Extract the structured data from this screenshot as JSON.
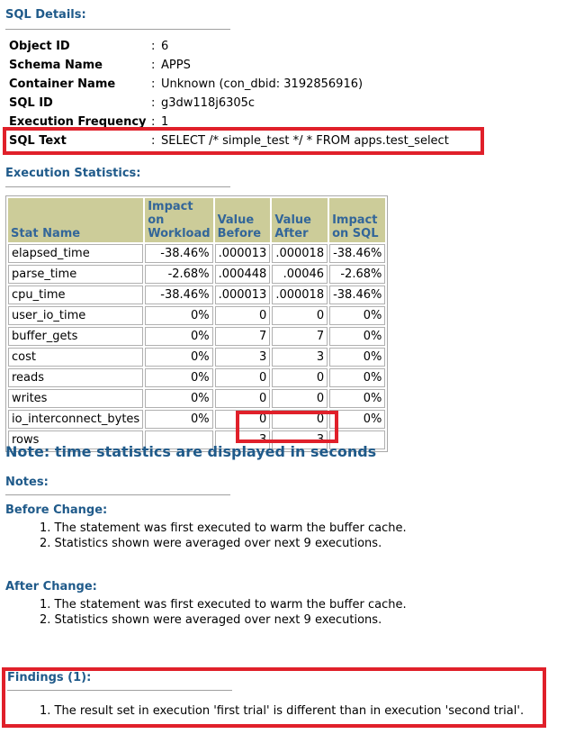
{
  "sql_details": {
    "title": "SQL Details:",
    "fields": [
      {
        "label": "Object ID",
        "value": "6"
      },
      {
        "label": "Schema Name",
        "value": "APPS"
      },
      {
        "label": "Container Name",
        "value": "Unknown (con_dbid: 3192856916)"
      },
      {
        "label": "SQL ID",
        "value": "g3dw118j6305c"
      },
      {
        "label": "Execution Frequency",
        "value": "1"
      },
      {
        "label": "SQL Text",
        "value": "SELECT /* simple_test */ * FROM apps.test_select"
      }
    ],
    "separator": ":"
  },
  "execution_statistics": {
    "title": "Execution Statistics:",
    "columns": [
      "Stat Name",
      "Impact on Workload",
      "Value Before",
      "Value After",
      "Impact on SQL"
    ],
    "column_lines": [
      [
        "Stat Name"
      ],
      [
        "Impact on",
        "Workload"
      ],
      [
        "Value",
        "Before"
      ],
      [
        "Value",
        "After"
      ],
      [
        "Impact",
        "on SQL"
      ]
    ],
    "rows": [
      [
        "elapsed_time",
        "-38.46%",
        ".000013",
        ".000018",
        "-38.46%"
      ],
      [
        "parse_time",
        "-2.68%",
        ".000448",
        ".00046",
        "-2.68%"
      ],
      [
        "cpu_time",
        "-38.46%",
        ".000013",
        ".000018",
        "-38.46%"
      ],
      [
        "user_io_time",
        "0%",
        "0",
        "0",
        "0%"
      ],
      [
        "buffer_gets",
        "0%",
        "7",
        "7",
        "0%"
      ],
      [
        "cost",
        "0%",
        "3",
        "3",
        "0%"
      ],
      [
        "reads",
        "0%",
        "0",
        "0",
        "0%"
      ],
      [
        "writes",
        "0%",
        "0",
        "0",
        "0%"
      ],
      [
        "io_interconnect_bytes",
        "0%",
        "0",
        "0",
        "0%"
      ],
      [
        "rows",
        "",
        "3",
        "3",
        ""
      ]
    ]
  },
  "time_note": "Note: time statistics are displayed in seconds",
  "notes": {
    "title": "Notes:",
    "before_title": "Before Change:",
    "before_items": [
      "1. The statement was first executed to warm the buffer cache.",
      "2. Statistics shown were averaged over next 9 executions."
    ],
    "after_title": "After Change:",
    "after_items": [
      "1. The statement was first executed to warm the buffer cache.",
      "2. Statistics shown were averaged over next 9 executions."
    ]
  },
  "findings": {
    "title": "Findings (1):",
    "items": [
      "1. The result set in execution 'first trial' is different than in execution 'second trial'."
    ]
  },
  "colors": {
    "heading": "#1f5a8a",
    "table_header_bg": "#cccc99",
    "table_header_text": "#336699",
    "highlight": "#e0202a"
  }
}
